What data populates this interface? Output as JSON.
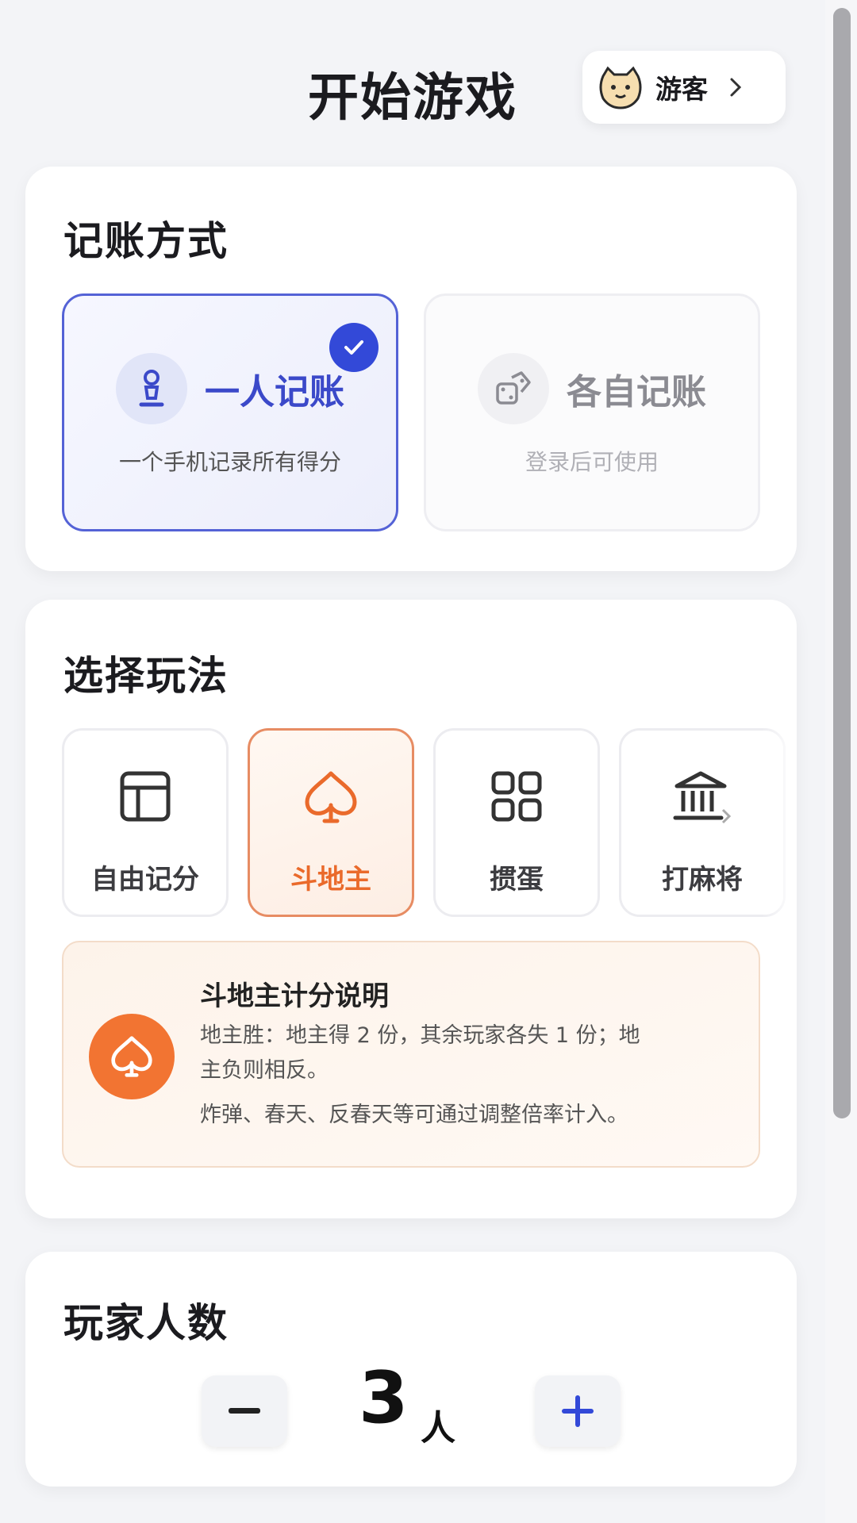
{
  "header": {
    "title": "开始游戏",
    "guest_label": "游客"
  },
  "accounting": {
    "title": "记账方式",
    "options": [
      {
        "label": "一人记账",
        "sub": "一个手机记录所有得分",
        "selected": true
      },
      {
        "label": "各自记账",
        "sub": "登录后可使用",
        "selected": false
      }
    ]
  },
  "play_mode": {
    "title": "选择玩法",
    "options": [
      {
        "label": "自由记分",
        "icon": "layout-icon",
        "selected": false
      },
      {
        "label": "斗地主",
        "icon": "spade-icon",
        "selected": true
      },
      {
        "label": "掼蛋",
        "icon": "grid-icon",
        "selected": false
      },
      {
        "label": "打麻将",
        "icon": "bank-icon",
        "selected": false
      }
    ],
    "rules": {
      "title": "斗地主计分说明",
      "line1": "地主胜：地主得 2 份，其余玩家各失 1 份；地",
      "line2": "主负则相反。",
      "line3": "炸弹、春天、反春天等可通过调整倍率计入。"
    }
  },
  "players": {
    "title": "玩家人数",
    "count": "3",
    "unit": "人",
    "minus": "−",
    "plus": "+"
  },
  "colors": {
    "accent_blue": "#3349d8",
    "accent_orange": "#f27432"
  }
}
